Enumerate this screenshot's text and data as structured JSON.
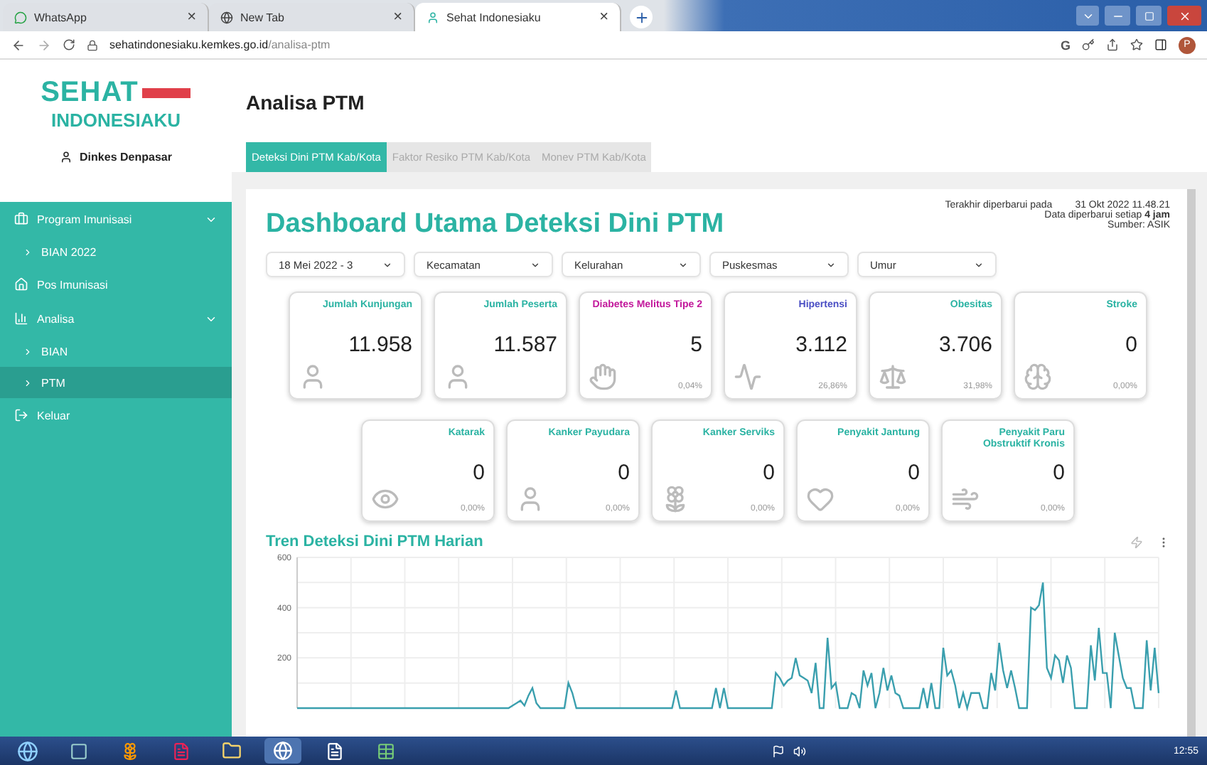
{
  "browser": {
    "tabs": [
      {
        "title": "WhatsApp",
        "selected": false
      },
      {
        "title": "New Tab",
        "selected": false
      },
      {
        "title": "Sehat Indonesiaku",
        "selected": true
      }
    ],
    "close_glyph": "×",
    "url_host": "sehatindonesiaku.kemkes.go.id",
    "url_path": "/analisa-ptm",
    "toolbar_letter": "G",
    "profile": "P"
  },
  "sidebar": {
    "logo_top": "SEHAT",
    "logo_bottom": "INDONESIAKU",
    "user": "Dinkes Denpasar",
    "items": [
      {
        "label": "Program Imunisasi",
        "kind": "briefcase",
        "expanded": true,
        "selected": false,
        "children": [
          {
            "label": "BIAN 2022",
            "selected": false
          }
        ]
      },
      {
        "label": "Pos Imunisasi",
        "kind": "home",
        "selected": false
      },
      {
        "label": "Analisa",
        "kind": "chart",
        "expanded": true,
        "selected": false,
        "children": [
          {
            "label": "BIAN",
            "selected": false
          },
          {
            "label": "PTM",
            "selected": true
          }
        ]
      },
      {
        "label": "Keluar",
        "kind": "exit",
        "selected": false
      }
    ]
  },
  "page": {
    "title": "Analisa PTM",
    "tabs": [
      {
        "label": "Deteksi Dini PTM Kab/Kota",
        "selected": true
      },
      {
        "label": "Faktor Resiko PTM Kab/Kota",
        "selected": false
      },
      {
        "label": "Monev PTM Kab/Kota",
        "selected": false
      }
    ],
    "dashboard": {
      "heading": "Dashboard Utama Deteksi Dini PTM",
      "updated_label": "Terakhir diperbarui pada",
      "updated_at": "31 Okt 2022 11.48.21",
      "refresh_note": "Data diperbarui setiap **4 jam**",
      "source": "Sumber: ASIK",
      "filters": [
        {
          "value": "18 Mei 2022 - 3"
        },
        {
          "value": "Kecamatan"
        },
        {
          "value": "Kelurahan"
        },
        {
          "value": "Puskesmas"
        },
        {
          "value": "Umur"
        }
      ],
      "cards": [
        {
          "label": "Jumlah Kunjungan",
          "value": "11.958",
          "color": "#2bb3a3"
        },
        {
          "label": "Jumlah Peserta",
          "value": "11.587",
          "color": "#2bb3a3"
        },
        {
          "label": "Diabetes Melitus Tipe 2",
          "value": "5",
          "percent": "0,04%",
          "color": "#c2189b"
        },
        {
          "label": "Hipertensi",
          "value": "3.112",
          "percent": "26,86%",
          "color": "#4b4fc4"
        },
        {
          "label": "Obesitas",
          "value": "3.706",
          "percent": "31,98%",
          "color": "#2bb3a3"
        },
        {
          "label": "Stroke",
          "value": "0",
          "percent": "0,00%",
          "color": "#2bb3a3"
        },
        {
          "label": "Katarak",
          "value": "0",
          "percent": "0,00%",
          "color": "#2bb3a3"
        },
        {
          "label": "Kanker Payudara",
          "value": "0",
          "percent": "0,00%",
          "color": "#2bb3a3"
        },
        {
          "label": "Kanker Serviks",
          "value": "0",
          "percent": "0,00%",
          "color": "#2bb3a3"
        },
        {
          "label": "Penyakit Jantung",
          "value": "0",
          "percent": "0,00%",
          "color": "#2bb3a3"
        },
        {
          "label": "Penyakit Paru Obstruktif Kronis",
          "value": "0",
          "percent": "0,00%",
          "color": "#2bb3a3"
        }
      ],
      "chart": {
        "title": "Tren Deteksi Dini PTM Harian",
        "chart_data": {
          "type": "line",
          "ylim": [
            0,
            600
          ],
          "yticks": [
            200,
            400,
            600
          ],
          "series": [
            {
              "color": "#3a9fae",
              "values": [
                0,
                0,
                0,
                0,
                0,
                0,
                0,
                0,
                0,
                0,
                0,
                0,
                0,
                0,
                0,
                0,
                0,
                0,
                0,
                0,
                0,
                0,
                0,
                0,
                0,
                0,
                0,
                0,
                0,
                0,
                0,
                0,
                0,
                0,
                0,
                0,
                0,
                0,
                0,
                0,
                0,
                0,
                0,
                0,
                0,
                0,
                0,
                0,
                0,
                0,
                0,
                0,
                0,
                0,
                10,
                20,
                30,
                10,
                50,
                80,
                20,
                0,
                0,
                0,
                0,
                0,
                0,
                0,
                100,
                60,
                0,
                0,
                0,
                0,
                0,
                0,
                0,
                0,
                0,
                0,
                0,
                0,
                0,
                0,
                0,
                0,
                0,
                0,
                0,
                0,
                0,
                0,
                0,
                0,
                0,
                70,
                0,
                0,
                0,
                0,
                0,
                0,
                0,
                0,
                0,
                80,
                0,
                80,
                0,
                0,
                0,
                0,
                0,
                0,
                0,
                0,
                0,
                0,
                0,
                0,
                140,
                120,
                90,
                110,
                120,
                200,
                130,
                120,
                110,
                60,
                180,
                0,
                0,
                280,
                80,
                100,
                0,
                0,
                0,
                60,
                50,
                0,
                150,
                90,
                140,
                0,
                60,
                160,
                70,
                130,
                60,
                50,
                0,
                0,
                0,
                0,
                0,
                80,
                0,
                100,
                0,
                0,
                240,
                130,
                150,
                90,
                0,
                60,
                0,
                60,
                60,
                60,
                0,
                0,
                140,
                70,
                260,
                150,
                80,
                150,
                80,
                0,
                0,
                0,
                400,
                390,
                410,
                500,
                160,
                120,
                210,
                190,
                100,
                210,
                160,
                0,
                0,
                0,
                0,
                250,
                110,
                320,
                140,
                140,
                0,
                300,
                210,
                120,
                80,
                80,
                0,
                0,
                0,
                270,
                70,
                240,
                60
              ]
            }
          ]
        }
      }
    }
  },
  "taskbar": {
    "clock": "12:55"
  }
}
